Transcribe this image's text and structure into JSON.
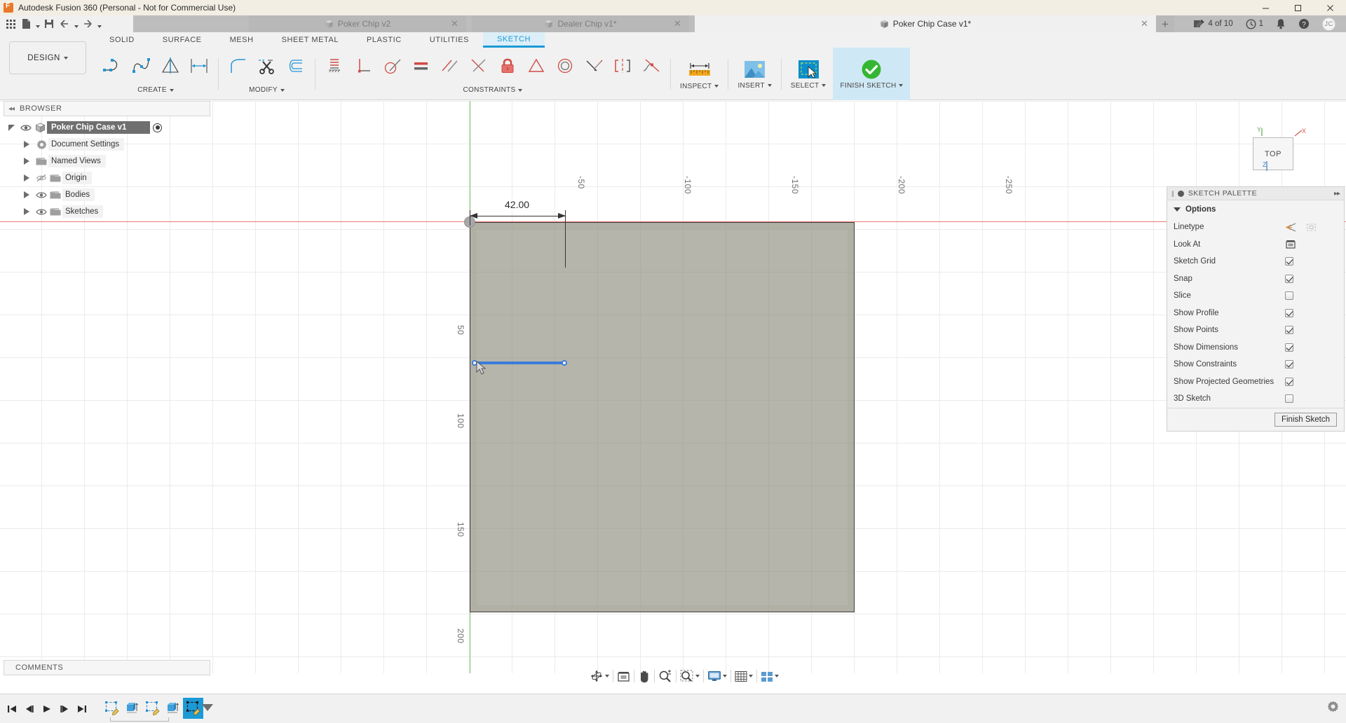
{
  "window": {
    "title": "Autodesk Fusion 360 (Personal - Not for Commercial Use)",
    "logo_icon": "fusion-logo-icon",
    "minimize_label": "—",
    "maximize_label": "☐",
    "close_label": "✕"
  },
  "quick_access": {
    "apps_icon": "app-grid-icon",
    "new_icon": "new-document-icon",
    "save_icon": "save-icon",
    "undo_icon": "undo-icon",
    "redo_icon": "redo-icon"
  },
  "document_tabs": [
    {
      "label": "Poker Chip v2",
      "active": false,
      "close_label": "✕",
      "icon": "document-cube-icon"
    },
    {
      "label": "Dealer Chip v1*",
      "active": false,
      "close_label": "✕",
      "icon": "document-cube-icon"
    },
    {
      "label": "Poker Chip Case v1*",
      "active": true,
      "close_label": "✕",
      "icon": "document-cube-icon"
    }
  ],
  "tab_add_label": "+",
  "account_bar": {
    "jobs_icon": "jobs-pencil-icon",
    "jobs_label": "4 of 10",
    "clock_icon": "clock-icon",
    "clock_label": "1",
    "bell_icon": "bell-icon",
    "help_icon": "help-icon",
    "avatar_initials": "JC"
  },
  "ribbon": {
    "workspace_label": "DESIGN",
    "tabs": [
      {
        "label": "SOLID",
        "active": false
      },
      {
        "label": "SURFACE",
        "active": false
      },
      {
        "label": "MESH",
        "active": false
      },
      {
        "label": "SHEET METAL",
        "active": false
      },
      {
        "label": "PLASTIC",
        "active": false
      },
      {
        "label": "UTILITIES",
        "active": false
      },
      {
        "label": "SKETCH",
        "active": true
      }
    ],
    "panels": [
      {
        "label": "CREATE",
        "tools": [
          "sketch-line-icon",
          "spline-icon",
          "mirror-icon",
          "sketch-dimension-icon"
        ]
      },
      {
        "label": "MODIFY",
        "tools": [
          "trim-scissors-icon",
          "offset-icon"
        ]
      },
      {
        "label": "CONSTRAINTS",
        "tools": [
          "constraint-fix-icon",
          "constraint-perpendicular-icon",
          "constraint-tangent-icon",
          "constraint-horizontal-vertical-icon",
          "constraint-parallel-icon",
          "constraint-midpoint-icon",
          "constraint-fix-lock-icon",
          "constraint-equal-icon",
          "constraint-concentric-icon",
          "constraint-collinear-icon",
          "constraint-symmetry-icon",
          "constraint-curvature-icon"
        ]
      }
    ],
    "big_tools": [
      {
        "label": "INSPECT",
        "icon": "measure-ruler-icon",
        "active": false
      },
      {
        "label": "INSERT",
        "icon": "insert-image-icon",
        "active": false
      },
      {
        "label": "SELECT",
        "icon": "select-cursor-icon",
        "active": false
      },
      {
        "label": "FINISH SKETCH",
        "icon": "finish-check-icon",
        "active": true
      }
    ]
  },
  "browser": {
    "title": "BROWSER",
    "collapse_icon": "collapse-left-icon",
    "nodes": [
      {
        "label": "Poker Chip Case v1",
        "icon": "component-cube-icon",
        "depth": 0,
        "selected": true,
        "eye": true,
        "radio": true
      },
      {
        "label": "Document Settings",
        "icon": "gear-icon",
        "depth": 1,
        "selected": false,
        "eye": false,
        "radio": false
      },
      {
        "label": "Named Views",
        "icon": "folder-icon",
        "depth": 1,
        "selected": false,
        "eye": false,
        "radio": false
      },
      {
        "label": "Origin",
        "icon": "folder-icon",
        "depth": 1,
        "selected": false,
        "eye": true,
        "eye_off": true,
        "radio": false
      },
      {
        "label": "Bodies",
        "icon": "folder-icon",
        "depth": 1,
        "selected": false,
        "eye": true,
        "radio": false
      },
      {
        "label": "Sketches",
        "icon": "folder-icon",
        "depth": 1,
        "selected": false,
        "eye": true,
        "radio": false
      }
    ]
  },
  "comments": {
    "title": "COMMENTS"
  },
  "canvas": {
    "dimension_value": "42.00",
    "view_cube_face": "TOP",
    "axis_x_label": "X",
    "axis_y_label": "Y",
    "axis_z_label": "Z",
    "grid_labels_horizontal": [
      "-50",
      "-100",
      "-150",
      "-200",
      "-250"
    ],
    "grid_labels_vertical": [
      "50",
      "100",
      "150",
      "200"
    ],
    "colors": {
      "x_axis": "#e77b74",
      "y_axis": "#79c46b",
      "selection": "#3a7cd9",
      "profile_fill": "#888878"
    }
  },
  "sketch_palette": {
    "title": "SKETCH PALETTE",
    "expand_icon": "expand-right-icon",
    "section_label": "Options",
    "rows": [
      {
        "label": "Linetype",
        "control": "icons",
        "icons": [
          "linetype-construction-icon",
          "linetype-centerline-icon"
        ]
      },
      {
        "label": "Look At",
        "control": "icon",
        "icons": [
          "look-at-icon"
        ]
      },
      {
        "label": "Sketch Grid",
        "control": "checkbox",
        "checked": true
      },
      {
        "label": "Snap",
        "control": "checkbox",
        "checked": true
      },
      {
        "label": "Slice",
        "control": "checkbox",
        "checked": false
      },
      {
        "label": "Show Profile",
        "control": "checkbox",
        "checked": true
      },
      {
        "label": "Show Points",
        "control": "checkbox",
        "checked": true
      },
      {
        "label": "Show Dimensions",
        "control": "checkbox",
        "checked": true
      },
      {
        "label": "Show Constraints",
        "control": "checkbox",
        "checked": true
      },
      {
        "label": "Show Projected Geometries",
        "control": "checkbox",
        "checked": true
      },
      {
        "label": "3D Sketch",
        "control": "checkbox",
        "checked": false
      }
    ],
    "finish_button_label": "Finish Sketch"
  },
  "nav_bar": {
    "items": [
      {
        "icon": "orbit-icon",
        "caret": true
      },
      {
        "icon": "look-at-nav-icon",
        "caret": false
      },
      {
        "icon": "pan-hand-icon",
        "caret": false
      },
      {
        "icon": "zoom-magnifier-icon",
        "caret": false
      },
      {
        "icon": "zoom-window-icon",
        "caret": true
      },
      {
        "icon": "display-settings-icon",
        "caret": true
      },
      {
        "icon": "grid-snap-icon",
        "caret": true
      },
      {
        "icon": "viewports-icon",
        "caret": true
      }
    ]
  },
  "timeline": {
    "controls": [
      "go-to-beginning-icon",
      "step-back-icon",
      "play-icon",
      "step-forward-icon",
      "go-to-end-icon"
    ],
    "features": [
      {
        "icon": "sketch-feature-icon",
        "selected": false
      },
      {
        "icon": "extrude-feature-icon",
        "selected": false
      },
      {
        "icon": "sketch-feature-icon",
        "selected": false
      },
      {
        "icon": "extrude-feature-icon",
        "selected": false
      },
      {
        "icon": "sketch-feature-icon",
        "selected": true
      }
    ],
    "settings_icon": "gear-icon"
  }
}
